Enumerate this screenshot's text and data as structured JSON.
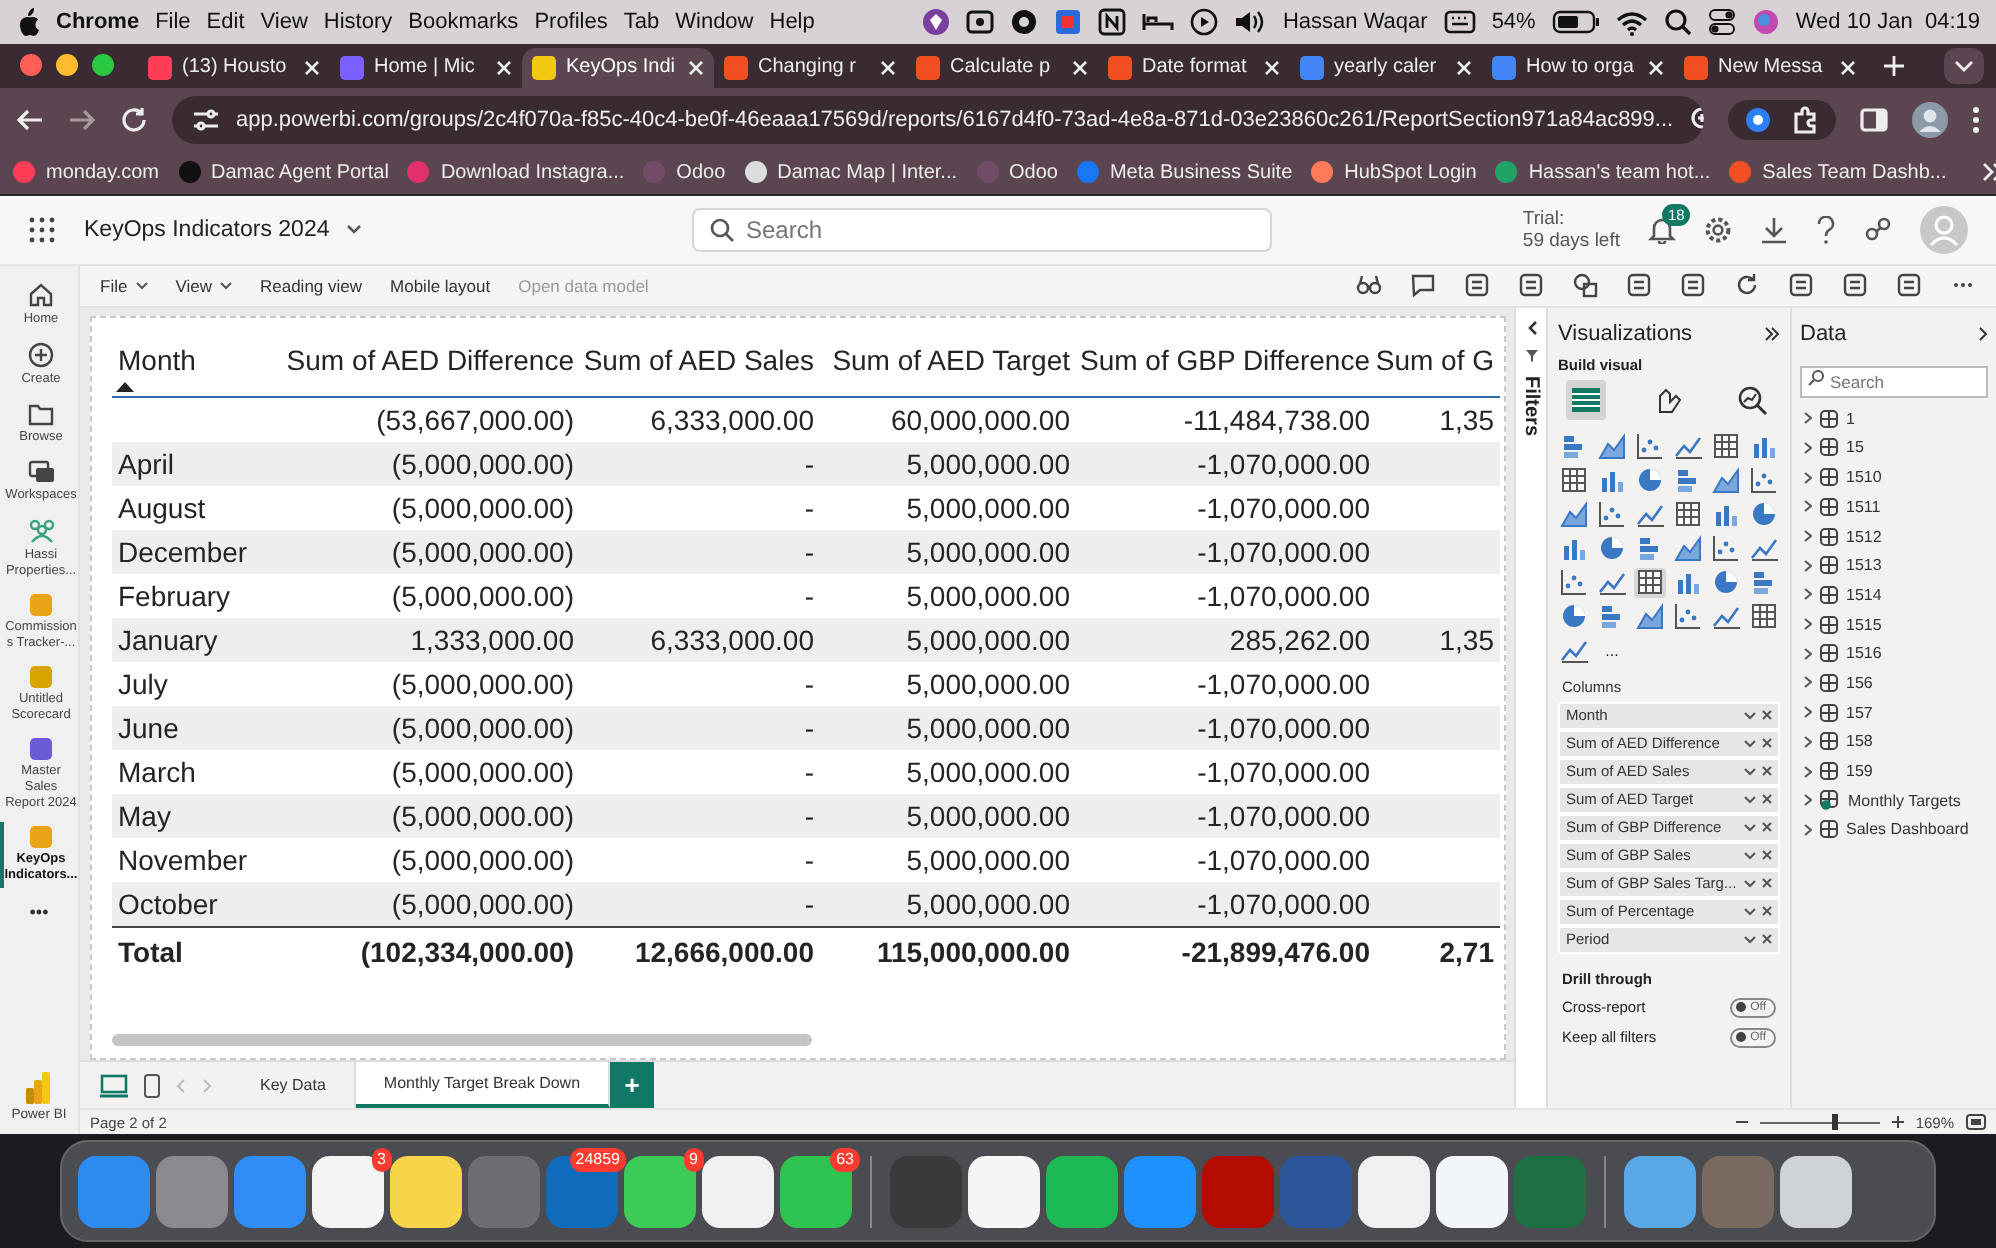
{
  "menubar": {
    "app": "Chrome",
    "menus": [
      "File",
      "Edit",
      "View",
      "History",
      "Bookmarks",
      "Profiles",
      "Tab",
      "Window",
      "Help"
    ],
    "user": "Hassan Waqar",
    "battery": "54%",
    "clock": "Wed 10 Jan  04:19"
  },
  "browser_tabs": [
    {
      "label": "(13) Housto",
      "selected": false,
      "color": "#ff3d57"
    },
    {
      "label": "Home | Mic",
      "selected": false,
      "color": "#7b61ff"
    },
    {
      "label": "KeyOps Indi",
      "selected": true,
      "color": "#f2c811"
    },
    {
      "label": "Changing r",
      "selected": false,
      "color": "#f25022"
    },
    {
      "label": "Calculate p",
      "selected": false,
      "color": "#f25022"
    },
    {
      "label": "Date format",
      "selected": false,
      "color": "#f25022"
    },
    {
      "label": "yearly caler",
      "selected": false,
      "color": "#4285f4"
    },
    {
      "label": "How to orga",
      "selected": false,
      "color": "#4285f4"
    },
    {
      "label": "New Messa",
      "selected": false,
      "color": "#f25022"
    }
  ],
  "address": "app.powerbi.com/groups/2c4f070a-f85c-40c4-be0f-46eaaa17569d/reports/6167d4f0-73ad-4e8a-871d-03e23860c261/ReportSection971a84ac899...",
  "bookmarks": [
    {
      "label": "monday.com",
      "color": "#ff3d57"
    },
    {
      "label": "Damac Agent Portal",
      "color": "#111111"
    },
    {
      "label": "Download Instagra...",
      "color": "#e1306c"
    },
    {
      "label": "Odoo",
      "color": "#714b67"
    },
    {
      "label": "Damac Map | Inter...",
      "color": "#dddddd"
    },
    {
      "label": "Odoo",
      "color": "#714b67"
    },
    {
      "label": "Meta Business Suite",
      "color": "#1877f2"
    },
    {
      "label": "HubSpot Login",
      "color": "#ff7a59"
    },
    {
      "label": "Hassan's team hot...",
      "color": "#21a366"
    },
    {
      "label": "Sales Team Dashb...",
      "color": "#f25022"
    }
  ],
  "report_header": {
    "title": "KeyOps Indicators 2024",
    "search": {
      "placeholder": "Search"
    },
    "trial": "Trial:",
    "trial_days": "59 days left",
    "notifications": "18"
  },
  "nav": [
    {
      "label": "Home",
      "kind": "home",
      "selected": false
    },
    {
      "label": "Create",
      "kind": "create",
      "selected": false
    },
    {
      "label": "Browse",
      "kind": "browse",
      "selected": false
    },
    {
      "label": "Workspaces",
      "kind": "workspaces",
      "selected": false
    },
    {
      "label": "Hassi Properties...",
      "kind": "app",
      "selected": false,
      "color": "#3aa37a"
    },
    {
      "label": "Commission s Tracker-...",
      "kind": "item",
      "selected": false,
      "color": "#e8a317"
    },
    {
      "label": "Untitled Scorecard",
      "kind": "item",
      "selected": false,
      "color": "#d9a400"
    },
    {
      "label": "Master Sales Report 2024",
      "kind": "item",
      "selected": false,
      "color": "#6b5bd6"
    },
    {
      "label": "KeyOps Indicators...",
      "kind": "item",
      "selected": true,
      "color": "#e8a317"
    }
  ],
  "nav_more": "•••",
  "brand": "Power BI",
  "ribbon": [
    {
      "label": "File",
      "menu": true,
      "disabled": false
    },
    {
      "label": "View",
      "menu": true,
      "disabled": false
    },
    {
      "label": "Reading view",
      "menu": false,
      "disabled": false
    },
    {
      "label": "Mobile layout",
      "menu": false,
      "disabled": false
    },
    {
      "label": "Open data model",
      "menu": false,
      "disabled": true
    }
  ],
  "table": {
    "columns": [
      {
        "label": "Month",
        "sorted": true
      },
      {
        "label": "Sum of AED Difference",
        "sorted": false
      },
      {
        "label": "Sum of AED Sales",
        "sorted": false
      },
      {
        "label": "Sum of AED Target",
        "sorted": false
      },
      {
        "label": "Sum of GBP Difference",
        "sorted": false
      },
      {
        "label": "Sum of G",
        "sorted": false
      }
    ],
    "rows": [
      [
        "",
        "(53,667,000.00)",
        "6,333,000.00",
        "60,000,000.00",
        "-11,484,738.00",
        "1,35"
      ],
      [
        "April",
        "(5,000,000.00)",
        "-",
        "5,000,000.00",
        "-1,070,000.00",
        ""
      ],
      [
        "August",
        "(5,000,000.00)",
        "-",
        "5,000,000.00",
        "-1,070,000.00",
        ""
      ],
      [
        "December",
        "(5,000,000.00)",
        "-",
        "5,000,000.00",
        "-1,070,000.00",
        ""
      ],
      [
        "February",
        "(5,000,000.00)",
        "-",
        "5,000,000.00",
        "-1,070,000.00",
        ""
      ],
      [
        "January",
        "1,333,000.00",
        "6,333,000.00",
        "5,000,000.00",
        "285,262.00",
        "1,35"
      ],
      [
        "July",
        "(5,000,000.00)",
        "-",
        "5,000,000.00",
        "-1,070,000.00",
        ""
      ],
      [
        "June",
        "(5,000,000.00)",
        "-",
        "5,000,000.00",
        "-1,070,000.00",
        ""
      ],
      [
        "March",
        "(5,000,000.00)",
        "-",
        "5,000,000.00",
        "-1,070,000.00",
        ""
      ],
      [
        "May",
        "(5,000,000.00)",
        "-",
        "5,000,000.00",
        "-1,070,000.00",
        ""
      ],
      [
        "November",
        "(5,000,000.00)",
        "-",
        "5,000,000.00",
        "-1,070,000.00",
        ""
      ],
      [
        "October",
        "(5,000,000.00)",
        "-",
        "5,000,000.00",
        "-1,070,000.00",
        ""
      ]
    ],
    "total": [
      "Total",
      "(102,334,000.00)",
      "12,666,000.00",
      "115,000,000.00",
      "-21,899,476.00",
      "2,71"
    ]
  },
  "page_tabs": [
    {
      "label": "Key Data",
      "selected": false
    },
    {
      "label": "Monthly Target Break Down",
      "selected": true
    }
  ],
  "add_page": "+",
  "filters": {
    "title": "Filters"
  },
  "visualizations": {
    "title": "Visualizations",
    "build_visual": "Build visual",
    "modes": [
      {
        "selected": true
      },
      {
        "selected": false
      },
      {
        "selected": false
      }
    ],
    "types": [
      {
        "selected": false
      },
      {
        "selected": false
      },
      {
        "selected": false
      },
      {
        "selected": false
      },
      {
        "selected": false
      },
      {
        "selected": false
      },
      {
        "selected": false
      },
      {
        "selected": false
      },
      {
        "selected": false
      },
      {
        "selected": false
      },
      {
        "selected": false
      },
      {
        "selected": false
      },
      {
        "selected": false
      },
      {
        "selected": false
      },
      {
        "selected": false
      },
      {
        "selected": false
      },
      {
        "selected": false
      },
      {
        "selected": false
      },
      {
        "selected": false
      },
      {
        "selected": false
      },
      {
        "selected": false
      },
      {
        "selected": false
      },
      {
        "selected": false
      },
      {
        "selected": false
      },
      {
        "selected": false
      },
      {
        "selected": false
      },
      {
        "selected": true
      },
      {
        "selected": false
      },
      {
        "selected": false
      },
      {
        "selected": false
      },
      {
        "selected": false
      },
      {
        "selected": false
      },
      {
        "selected": false
      },
      {
        "selected": false
      },
      {
        "selected": false
      },
      {
        "selected": false
      },
      {
        "selected": false
      }
    ],
    "more": "...",
    "columns_title": "Columns",
    "fields": [
      "Month",
      "Sum of AED Difference",
      "Sum of AED Sales",
      "Sum of AED Target",
      "Sum of GBP Difference",
      "Sum of GBP Sales",
      "Sum of GBP Sales Targ...",
      "Sum of Percentage",
      "Period"
    ],
    "drill_title": "Drill through",
    "toggles": [
      {
        "label": "Cross-report",
        "on": false,
        "text": "Off"
      },
      {
        "label": "Keep all filters",
        "on": false,
        "text": "Off"
      }
    ]
  },
  "data": {
    "title": "Data",
    "search": {
      "placeholder": "Search"
    },
    "tables": [
      {
        "label": "1",
        "kind": "table"
      },
      {
        "label": "15",
        "kind": "table"
      },
      {
        "label": "1510",
        "kind": "table"
      },
      {
        "label": "1511",
        "kind": "table"
      },
      {
        "label": "1512",
        "kind": "table"
      },
      {
        "label": "1513",
        "kind": "table"
      },
      {
        "label": "1514",
        "kind": "table"
      },
      {
        "label": "1515",
        "kind": "table"
      },
      {
        "label": "1516",
        "kind": "table"
      },
      {
        "label": "156",
        "kind": "table"
      },
      {
        "label": "157",
        "kind": "table"
      },
      {
        "label": "158",
        "kind": "table"
      },
      {
        "label": "159",
        "kind": "table"
      },
      {
        "label": "Monthly Targets",
        "kind": "linked"
      },
      {
        "label": "Sales Dashboard",
        "kind": "table"
      }
    ]
  },
  "status": {
    "page": "Page 2 of 2",
    "zoom": "169%",
    "zoom_slider": {
      "level": 0.62
    }
  },
  "dock": [
    {
      "kind": "app",
      "color": "#2d8cf0"
    },
    {
      "kind": "app",
      "color": "#8a8a8f"
    },
    {
      "kind": "app",
      "color": "#2f8df5"
    },
    {
      "kind": "app",
      "color": "#f4f4f4",
      "badge": "3"
    },
    {
      "kind": "app",
      "color": "#f7d54a"
    },
    {
      "kind": "app",
      "color": "#6d6d72"
    },
    {
      "kind": "app",
      "color": "#0f6cbd",
      "badge": "24859"
    },
    {
      "kind": "app",
      "color": "#3ccd58",
      "badge": "9"
    },
    {
      "kind": "app",
      "color": "#f1f1f1"
    },
    {
      "kind": "app",
      "color": "#2dc44f",
      "badge": "63"
    },
    {
      "kind": "separator"
    },
    {
      "kind": "app",
      "color": "#3a3a3a"
    },
    {
      "kind": "app",
      "color": "#f5f5f5"
    },
    {
      "kind": "app",
      "color": "#1db954"
    },
    {
      "kind": "app",
      "color": "#1e90ff"
    },
    {
      "kind": "app",
      "color": "#b30b00"
    },
    {
      "kind": "app",
      "color": "#2b579a"
    },
    {
      "kind": "app",
      "color": "#f0f0f0"
    },
    {
      "kind": "app",
      "color": "#f2f6f8"
    },
    {
      "kind": "app",
      "color": "#1d7044"
    },
    {
      "kind": "separator"
    },
    {
      "kind": "app",
      "color": "#5aa8e8"
    },
    {
      "kind": "app",
      "color": "#7a6a60"
    },
    {
      "kind": "app",
      "color": "#cfd3d6"
    }
  ]
}
